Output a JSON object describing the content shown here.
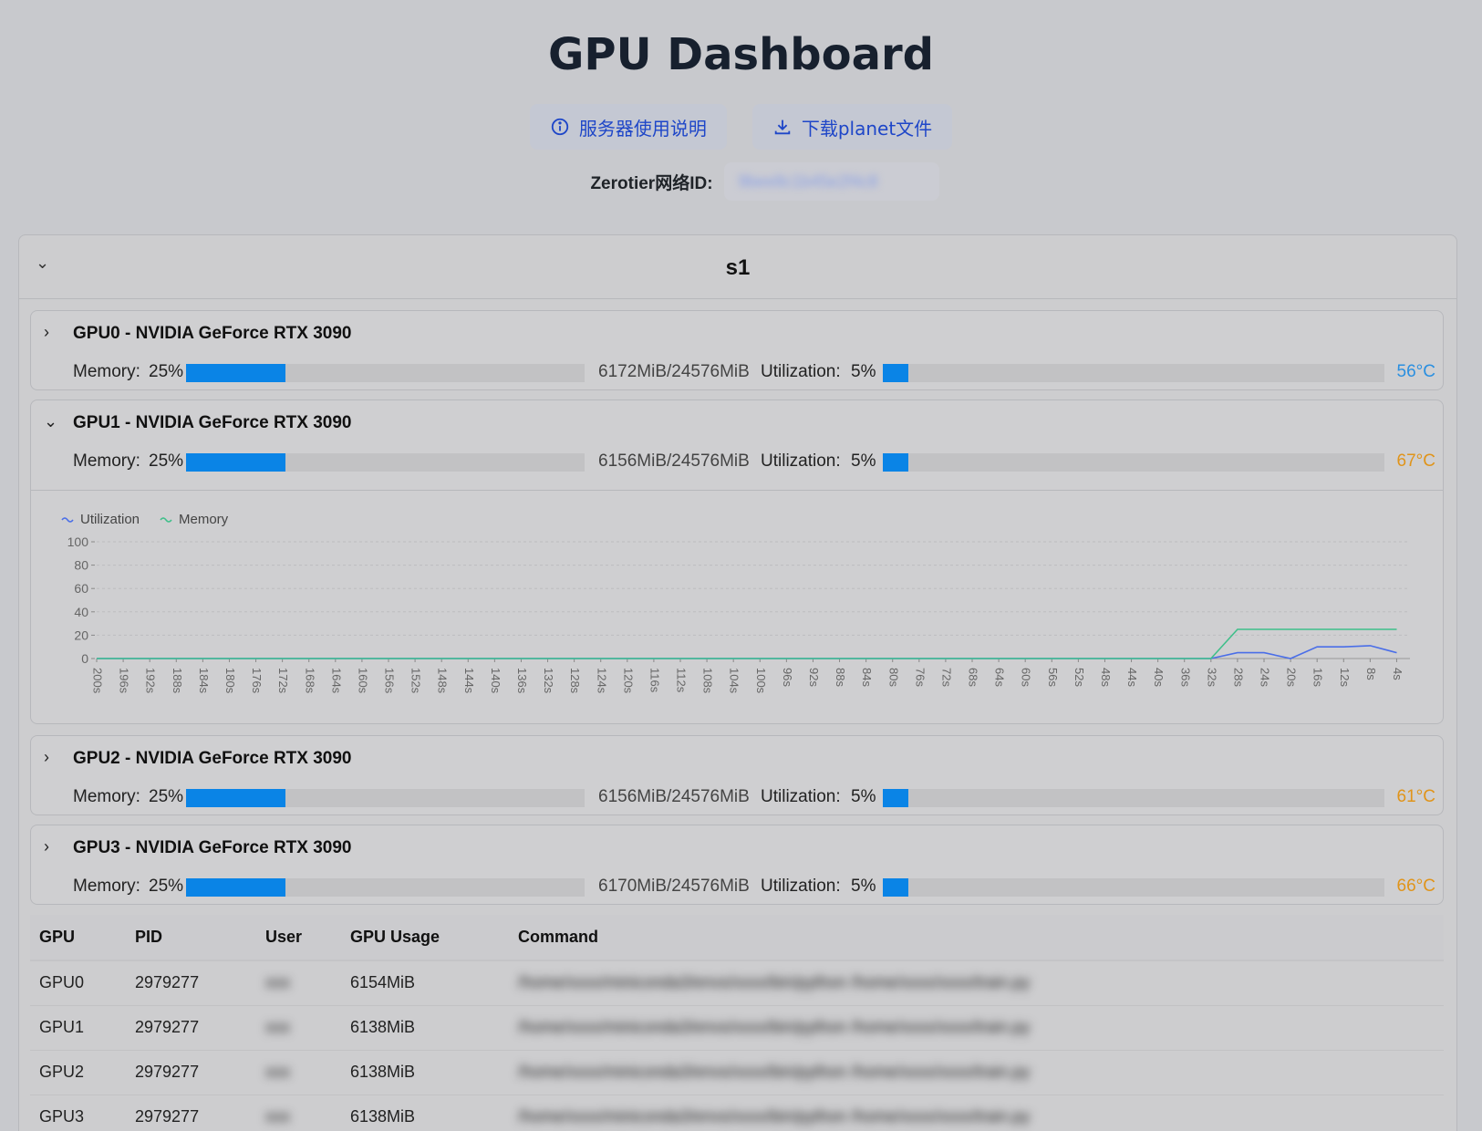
{
  "header": {
    "title": "GPU Dashboard",
    "help_button": "服务器使用说明",
    "download_button": "下载planet文件",
    "zerotier_label": "Zerotier网络ID:",
    "zerotier_value": "9bee8c1b45e2f4c8"
  },
  "server": {
    "name": "s1"
  },
  "labels": {
    "memory": "Memory:",
    "utilization": "Utilization:"
  },
  "gpus": [
    {
      "name": "GPU0 - NVIDIA GeForce RTX 3090",
      "mem_pct_label": "25%",
      "mem_pct": 0.25,
      "mem_text": "6172MiB/24576MiB",
      "util_pct_label": "5%",
      "util_pct": 0.05,
      "temp": "56°C",
      "temp_color": "#2a8fe0",
      "expanded": false
    },
    {
      "name": "GPU1 - NVIDIA GeForce RTX 3090",
      "mem_pct_label": "25%",
      "mem_pct": 0.25,
      "mem_text": "6156MiB/24576MiB",
      "util_pct_label": "5%",
      "util_pct": 0.05,
      "temp": "67°C",
      "temp_color": "#e0941a",
      "expanded": true
    },
    {
      "name": "GPU2 - NVIDIA GeForce RTX 3090",
      "mem_pct_label": "25%",
      "mem_pct": 0.25,
      "mem_text": "6156MiB/24576MiB",
      "util_pct_label": "5%",
      "util_pct": 0.05,
      "temp": "61°C",
      "temp_color": "#e0941a",
      "expanded": false
    },
    {
      "name": "GPU3 - NVIDIA GeForce RTX 3090",
      "mem_pct_label": "25%",
      "mem_pct": 0.25,
      "mem_text": "6170MiB/24576MiB",
      "util_pct_label": "5%",
      "util_pct": 0.05,
      "temp": "66°C",
      "temp_color": "#e0941a",
      "expanded": false
    }
  ],
  "chart_data": {
    "type": "line",
    "legend": [
      "Utilization",
      "Memory"
    ],
    "ylim": [
      0,
      100
    ],
    "yticks": [
      "100",
      "80",
      "60",
      "40",
      "20",
      "0"
    ],
    "x": [
      "200s",
      "196s",
      "192s",
      "188s",
      "184s",
      "180s",
      "176s",
      "172s",
      "168s",
      "164s",
      "160s",
      "156s",
      "152s",
      "148s",
      "144s",
      "140s",
      "136s",
      "132s",
      "128s",
      "124s",
      "120s",
      "116s",
      "112s",
      "108s",
      "104s",
      "100s",
      "96s",
      "92s",
      "88s",
      "84s",
      "80s",
      "76s",
      "72s",
      "68s",
      "64s",
      "60s",
      "56s",
      "52s",
      "48s",
      "44s",
      "40s",
      "36s",
      "32s",
      "28s",
      "24s",
      "20s",
      "16s",
      "12s",
      "8s",
      "4s"
    ],
    "series": [
      {
        "name": "Utilization",
        "color": "#4a6ee8",
        "values": [
          0,
          0,
          0,
          0,
          0,
          0,
          0,
          0,
          0,
          0,
          0,
          0,
          0,
          0,
          0,
          0,
          0,
          0,
          0,
          0,
          0,
          0,
          0,
          0,
          0,
          0,
          0,
          0,
          0,
          0,
          0,
          0,
          0,
          0,
          0,
          0,
          0,
          0,
          0,
          0,
          0,
          0,
          0,
          5,
          5,
          0,
          10,
          10,
          11,
          5
        ]
      },
      {
        "name": "Memory",
        "color": "#3fbf8a",
        "values": [
          0,
          0,
          0,
          0,
          0,
          0,
          0,
          0,
          0,
          0,
          0,
          0,
          0,
          0,
          0,
          0,
          0,
          0,
          0,
          0,
          0,
          0,
          0,
          0,
          0,
          0,
          0,
          0,
          0,
          0,
          0,
          0,
          0,
          0,
          0,
          0,
          0,
          0,
          0,
          0,
          0,
          0,
          0,
          25,
          25,
          25,
          25,
          25,
          25,
          25
        ]
      }
    ]
  },
  "table": {
    "headers": [
      "GPU",
      "PID",
      "User",
      "GPU Usage",
      "Command"
    ],
    "rows": [
      [
        "GPU0",
        "2979277",
        "xxx",
        "6154MiB",
        "/home/xxxx/miniconda3/envs/xxxx/bin/python /home/xxxx/xxxx/train.py"
      ],
      [
        "GPU1",
        "2979277",
        "xxx",
        "6138MiB",
        "/home/xxxx/miniconda3/envs/xxxx/bin/python /home/xxxx/xxxx/train.py"
      ],
      [
        "GPU2",
        "2979277",
        "xxx",
        "6138MiB",
        "/home/xxxx/miniconda3/envs/xxxx/bin/python /home/xxxx/xxxx/train.py"
      ],
      [
        "GPU3",
        "2979277",
        "xxx",
        "6138MiB",
        "/home/xxxx/miniconda3/envs/xxxx/bin/python /home/xxxx/xxxx/train.py"
      ]
    ]
  }
}
